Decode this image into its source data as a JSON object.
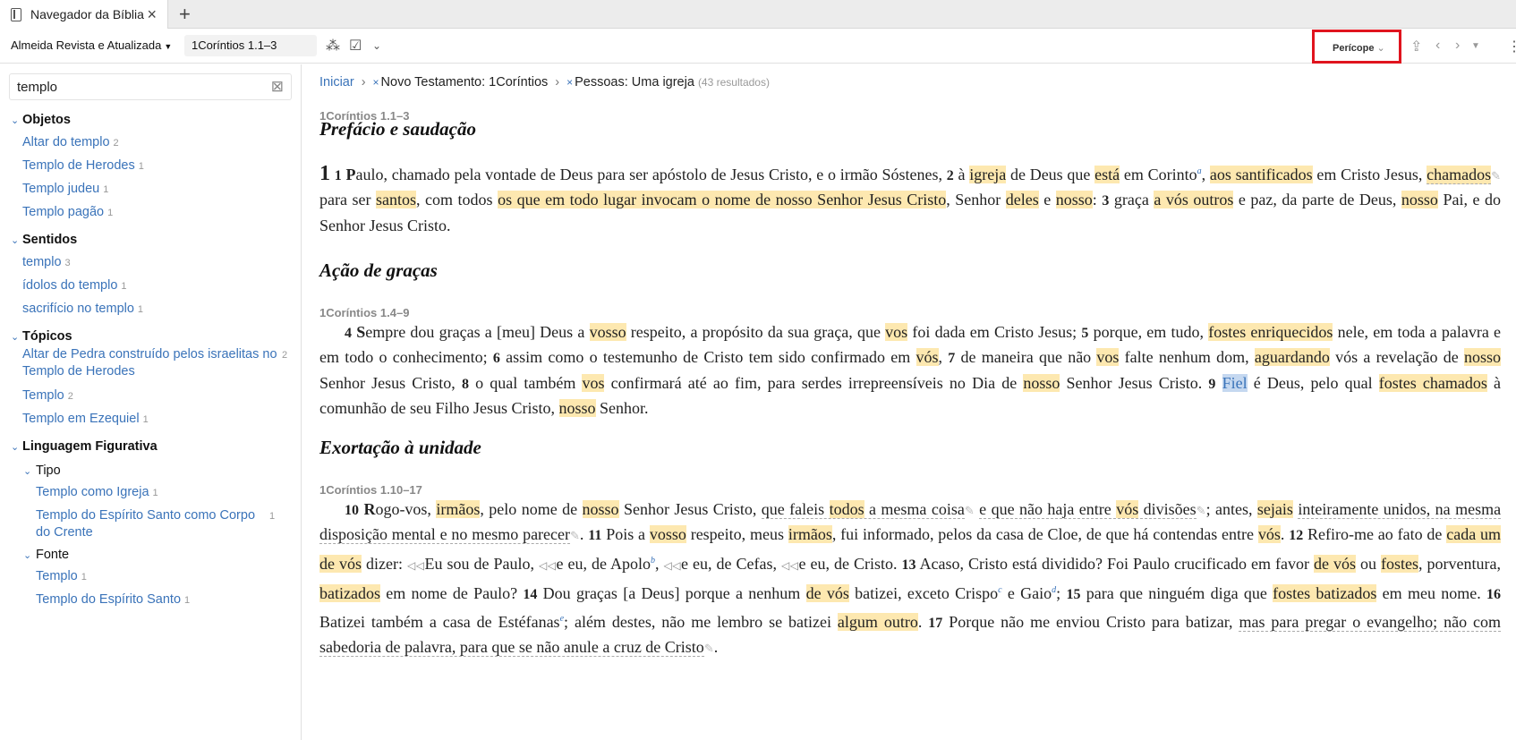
{
  "tab": {
    "title": "Navegador da Bíblia"
  },
  "toolbar": {
    "version": "Almeida Revista e Atualizada",
    "reference": "1Coríntios 1.1–3",
    "pericope": "Perícope"
  },
  "sidebar": {
    "search": "templo",
    "sections": [
      {
        "name": "Objetos",
        "items": [
          [
            "Altar do templo",
            "2"
          ],
          [
            "Templo de Herodes",
            "1"
          ],
          [
            "Templo judeu",
            "1"
          ],
          [
            "Templo pagão",
            "1"
          ]
        ]
      },
      {
        "name": "Sentidos",
        "items": [
          [
            "templo",
            "3"
          ],
          [
            "ídolos do templo",
            "1"
          ],
          [
            "sacrifício no templo",
            "1"
          ]
        ]
      },
      {
        "name": "Tópicos",
        "items": [
          [
            "Altar de Pedra construído pelos israelitas no",
            "2"
          ],
          [
            "Templo de Herodes",
            ""
          ],
          [
            "Templo",
            "2"
          ],
          [
            "Templo em Ezequiel",
            "1"
          ]
        ]
      },
      {
        "name": "Linguagem Figurativa"
      },
      {
        "name": "Tipo",
        "items": [
          [
            "Templo como Igreja",
            "1"
          ],
          [
            "Templo do Espírito Santo como Corpo",
            "1"
          ],
          [
            "do Crente",
            ""
          ]
        ]
      },
      {
        "name": "Fonte",
        "items": [
          [
            "Templo",
            "1"
          ],
          [
            "Templo do Espírito Santo",
            "1"
          ]
        ]
      }
    ]
  },
  "crumbs": {
    "home": "Iniciar",
    "c1": "Novo Testamento: 1Coríntios",
    "c2": "Pessoas: Uma igreja",
    "results": "(43 resultados)"
  },
  "passages": [
    {
      "ref": "1Coríntios 1.1–3",
      "heading": "Prefácio e saudação"
    },
    {
      "ref": "1Coríntios 1.4–9",
      "heading": "Ação de graças"
    },
    {
      "ref": "1Coríntios 1.10–17",
      "heading": "Exortação à unidade"
    }
  ]
}
